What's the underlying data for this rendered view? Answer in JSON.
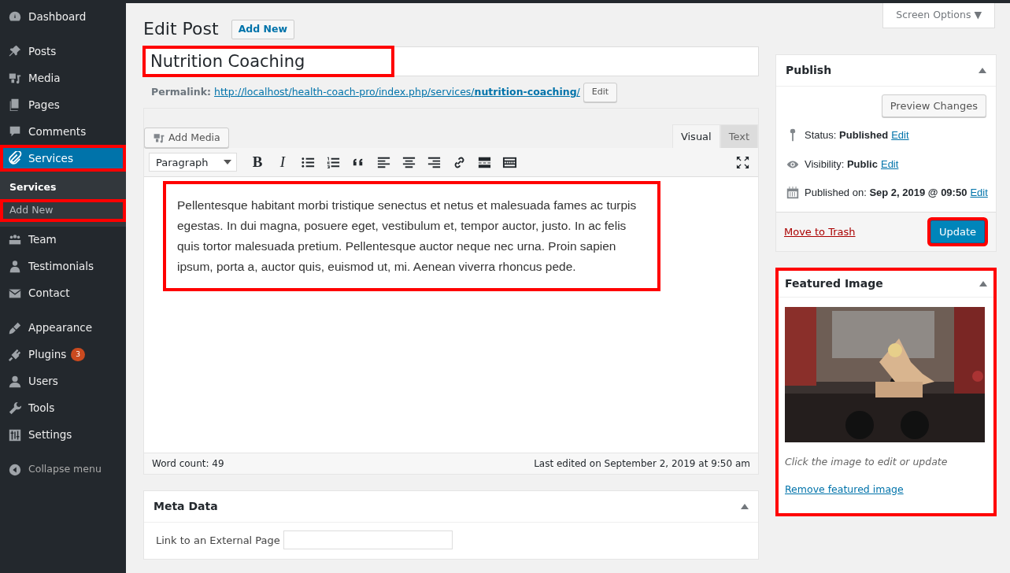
{
  "sidebar": {
    "groups": [
      [
        {
          "label": "Dashboard",
          "selected": false,
          "highlighted": false
        }
      ],
      [
        {
          "label": "Posts",
          "selected": false,
          "highlighted": false
        },
        {
          "label": "Media",
          "selected": false,
          "highlighted": false
        },
        {
          "label": "Pages",
          "selected": false,
          "highlighted": false
        },
        {
          "label": "Comments",
          "selected": false,
          "highlighted": false
        },
        {
          "label": "Services",
          "selected": true,
          "highlighted": true,
          "children": [
            {
              "label": "Services",
              "selected": true,
              "highlighted": false
            },
            {
              "label": "Add New",
              "selected": false,
              "highlighted": true
            }
          ]
        },
        {
          "label": "Team",
          "selected": false,
          "highlighted": false
        },
        {
          "label": "Testimonials",
          "selected": false,
          "highlighted": false
        },
        {
          "label": "Contact",
          "selected": false,
          "highlighted": false
        }
      ],
      [
        {
          "label": "Appearance",
          "selected": false,
          "highlighted": false
        },
        {
          "label": "Plugins",
          "selected": false,
          "highlighted": false,
          "badge": "3"
        },
        {
          "label": "Users",
          "selected": false,
          "highlighted": false
        },
        {
          "label": "Tools",
          "selected": false,
          "highlighted": false
        },
        {
          "label": "Settings",
          "selected": false,
          "highlighted": false
        }
      ]
    ],
    "collapse": "Collapse menu"
  },
  "screen_options": "Screen Options ▼",
  "page_title": "Edit Post",
  "add_new": "Add New",
  "post_title": {
    "value": "Nutrition Coaching",
    "highlighted": true
  },
  "permalink": {
    "label": "Permalink:",
    "url": "http://localhost/health-coach-pro/index.php/services/**nutrition-coaching**/",
    "edit": "Edit"
  },
  "editor": {
    "add_media": "Add Media",
    "tabs": [
      {
        "label": "Visual",
        "selected": true
      },
      {
        "label": "Text",
        "selected": false
      }
    ],
    "toolbar": [
      {
        "kind": "select",
        "value": "Paragraph"
      },
      {
        "kind": "glyph",
        "label": "B"
      },
      {
        "kind": "glyph",
        "label": "I"
      },
      {
        "kind": "icon"
      },
      {
        "kind": "icon"
      },
      {
        "kind": "icon"
      },
      {
        "kind": "icon"
      },
      {
        "kind": "icon"
      },
      {
        "kind": "icon"
      },
      {
        "kind": "icon"
      },
      {
        "kind": "icon"
      },
      {
        "kind": "icon"
      },
      {
        "kind": "spacer"
      },
      {
        "kind": "icon"
      }
    ],
    "content": {
      "text": "Pellentesque habitant morbi tristique senectus et netus et malesuada fames ac turpis egestas. In dui magna, posuere eget, vestibulum et, tempor auctor, justo. In ac felis quis tortor malesuada pretium. Pellentesque auctor neque nec urna. Proin sapien ipsum, porta a, auctor quis, euismod ut, mi. Aenean viverra rhoncus pede.",
      "highlighted": true
    },
    "word_count": "Word count: 49",
    "last_edited": "Last edited on September 2, 2019 at 9:50 am"
  },
  "meta_box": {
    "title": "Meta Data",
    "field_label": "Link to an External Page"
  },
  "publish": {
    "title": "Publish",
    "preview": "Preview Changes",
    "rows": [
      {
        "text": "Status: **Published**",
        "edit": "Edit"
      },
      {
        "text": "Visibility: **Public**",
        "edit": "Edit"
      },
      {
        "text": "Published on: **Sep 2, 2019 @ 09:50**",
        "edit": "Edit"
      }
    ],
    "trash": "Move to Trash",
    "update": {
      "label": "Update",
      "highlighted": true
    }
  },
  "featured_image": {
    "title": "Featured Image",
    "highlighted": true,
    "caption": "Click the image to edit or update",
    "remove": "Remove featured image"
  }
}
